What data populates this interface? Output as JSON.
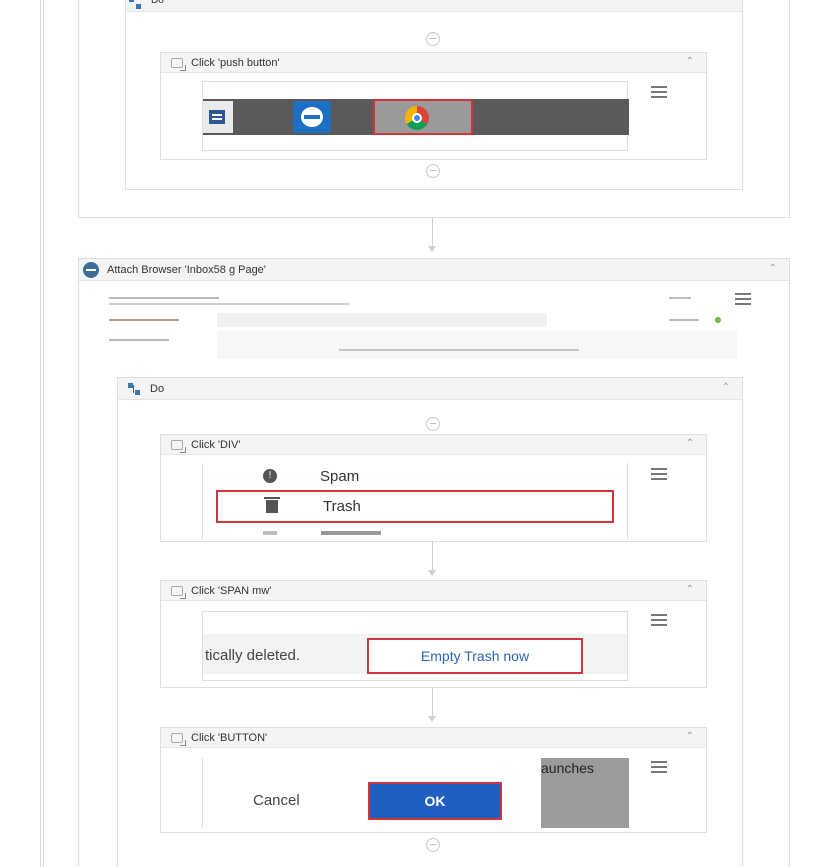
{
  "top_container": {
    "title": "Do"
  },
  "click_push": {
    "title": "Click 'push button'"
  },
  "attach": {
    "title": "Attach Browser 'Inbox58 g Page'"
  },
  "do_block": {
    "title": "Do"
  },
  "click_div": {
    "title": "Click 'DIV'",
    "menu_items": [
      {
        "label": "Spam",
        "icon": "spam-icon"
      },
      {
        "label": "Trash",
        "icon": "trash-icon"
      }
    ]
  },
  "click_span": {
    "title": "Click 'SPAN mw'",
    "text_before": "tically deleted.",
    "link": "Empty Trash now"
  },
  "click_button": {
    "title": "Click 'BUTTON'",
    "cancel": "Cancel",
    "ok": "OK",
    "side_text": "aunches"
  },
  "colors": {
    "highlight": "#d0353b",
    "ok_blue": "#1f5fc1",
    "link_blue": "#2a63b8",
    "taskbar": "#5a5a5a"
  }
}
